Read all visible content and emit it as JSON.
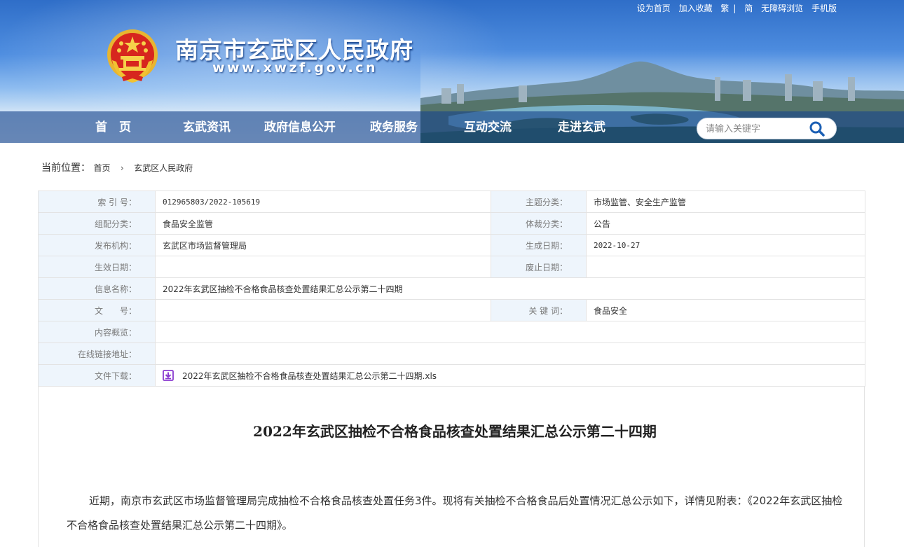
{
  "header": {
    "site_title": "南京市玄武区人民政府",
    "site_url": "www.xwzf.gov.cn",
    "top_links": [
      "设为首页",
      "加入收藏",
      "繁",
      "简",
      "无障碍浏览",
      "手机版"
    ]
  },
  "nav": {
    "items": [
      "首　页",
      "玄武资讯",
      "政府信息公开",
      "政务服务",
      "互动交流",
      "走进玄武"
    ]
  },
  "search": {
    "placeholder": "请输入关键字"
  },
  "breadcrumb": {
    "label": "当前位置：",
    "items": [
      "首页",
      "玄武区人民政府"
    ]
  },
  "info": {
    "index_no_label": "索 引 号：",
    "index_no": "012965803/2022-105619",
    "topic_label": "主题分类：",
    "topic": "市场监管、安全生产监管",
    "group_label": "组配分类：",
    "group": "食品安全监管",
    "genre_label": "体裁分类：",
    "genre": "公告",
    "publisher_label": "发布机构：",
    "publisher": "玄武区市场监督管理局",
    "created_label": "生成日期：",
    "created": "2022-10-27",
    "effective_label": "生效日期：",
    "effective": "",
    "expire_label": "废止日期：",
    "expire": "",
    "name_label": "信息名称：",
    "name": "2022年玄武区抽检不合格食品核查处置结果汇总公示第二十四期",
    "doc_no_label": "文　　号：",
    "doc_no": "",
    "keywords_label": "关 键 词：",
    "keywords": "食品安全",
    "summary_label": "内容概览：",
    "summary": "",
    "link_label": "在线链接地址：",
    "link": "",
    "download_label": "文件下载：",
    "download_file": "2022年玄武区抽检不合格食品核查处置结果汇总公示第二十四期.xls"
  },
  "article": {
    "title": "2022年玄武区抽检不合格食品核查处置结果汇总公示第二十四期",
    "body": "近期，南京市玄武区市场监督管理局完成抽检不合格食品核查处置任务3件。现将有关抽检不合格食品后处置情况汇总公示如下，详情见附表：《2022年玄武区抽检不合格食品核查处置结果汇总公示第二十四期》。"
  },
  "icons": {
    "emblem": "national-emblem-icon",
    "search": "search-icon",
    "download": "download-icon"
  },
  "colors": {
    "header_blue": "#2f6ec8",
    "nav_bar": "#18468c",
    "table_label_bg": "#eef5fc",
    "download_icon": "#8b3bd0"
  }
}
